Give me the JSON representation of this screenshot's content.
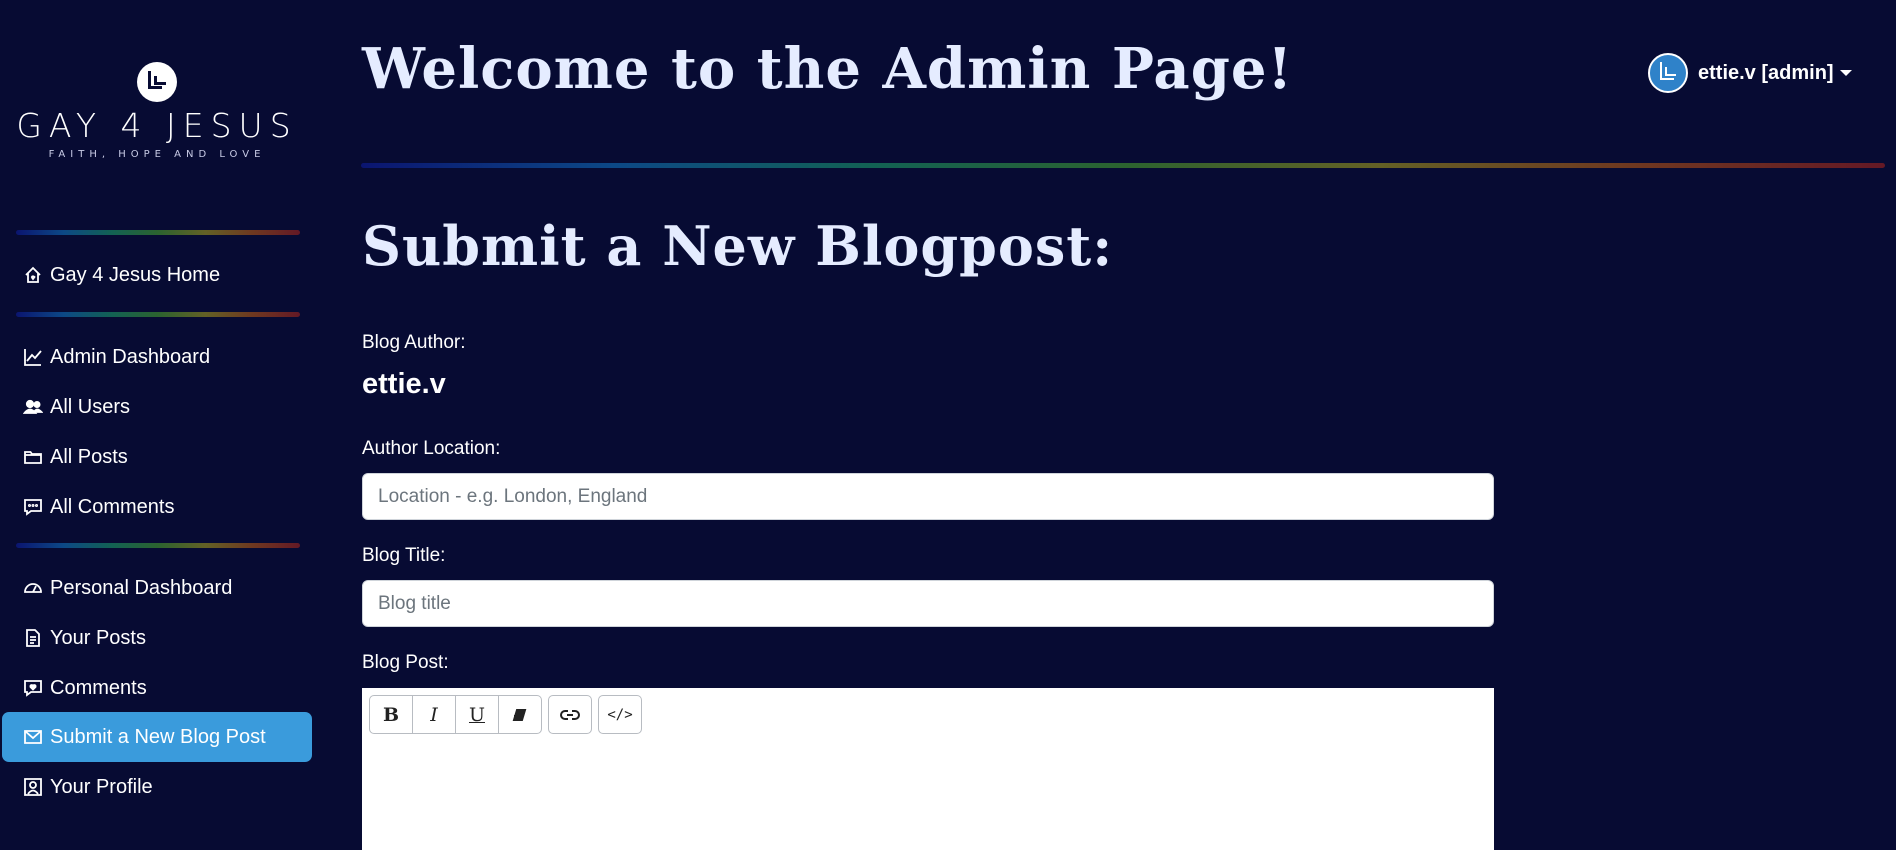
{
  "sidebar": {
    "logo": {
      "name": "GAY 4 JESUS",
      "tagline": "FAITH, HOPE AND LOVE"
    },
    "items": [
      {
        "label": "Gay 4 Jesus Home",
        "icon": "home-icon"
      },
      {
        "label": "Admin Dashboard",
        "icon": "chart-line-icon"
      },
      {
        "label": "All Users",
        "icon": "users-icon"
      },
      {
        "label": "All Posts",
        "icon": "folder-icon"
      },
      {
        "label": "All Comments",
        "icon": "comments-icon"
      },
      {
        "label": "Personal Dashboard",
        "icon": "speedometer-icon"
      },
      {
        "label": "Your Posts",
        "icon": "document-icon"
      },
      {
        "label": "Comments",
        "icon": "comment-heart-icon"
      },
      {
        "label": "Submit a New Blog Post",
        "icon": "envelope-icon",
        "active": true
      },
      {
        "label": "Your Profile",
        "icon": "person-square-icon"
      }
    ]
  },
  "header": {
    "title": "Welcome to the Admin Page!",
    "user": {
      "name": "ettie.v [admin]"
    }
  },
  "form": {
    "heading": "Submit a New Blogpost:",
    "author_label": "Blog Author:",
    "author_value": "ettie.v",
    "location_label": "Author Location:",
    "location_placeholder": "Location - e.g. London, England",
    "location_value": "",
    "title_label": "Blog Title:",
    "title_placeholder": "Blog title",
    "title_value": "",
    "post_label": "Blog Post:",
    "toolbar": {
      "bold": "B",
      "italic": "I",
      "underline": "U",
      "code": "</>"
    }
  },
  "colors": {
    "background": "#070b33",
    "accent": "#3a9bdc",
    "heading": "#e5ecff"
  }
}
